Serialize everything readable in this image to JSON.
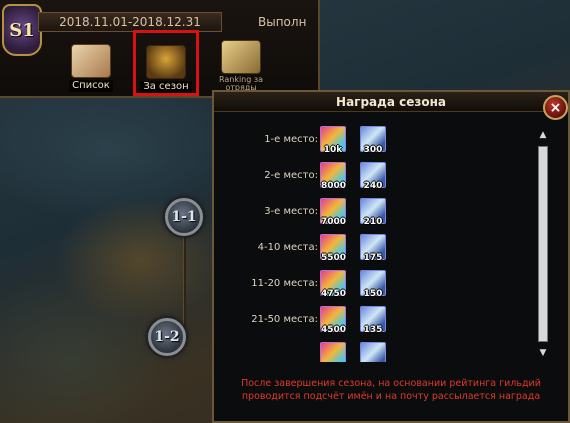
{
  "header": {
    "date_range": "2018.11.01-2018.12.31",
    "title_right": "Выполн",
    "season_badge": "S1"
  },
  "tabs": [
    {
      "label": "Список",
      "icon": "scroll-icon"
    },
    {
      "label": "За сезон",
      "icon": "treasure-chest-icon",
      "selected": true
    },
    {
      "label": "Ranking за отряды",
      "icon": "open-book-icon"
    }
  ],
  "map": {
    "nodes": [
      "1-1",
      "1-2"
    ]
  },
  "panel": {
    "title": "Награда сезона",
    "close_label": "×",
    "rows": [
      {
        "place": "1-е место:",
        "reward_a": "10k",
        "reward_b": "300"
      },
      {
        "place": "2-е место:",
        "reward_a": "8000",
        "reward_b": "240"
      },
      {
        "place": "3-е место:",
        "reward_a": "7000",
        "reward_b": "210"
      },
      {
        "place": "4-10 места:",
        "reward_a": "5500",
        "reward_b": "175"
      },
      {
        "place": "11-20 места:",
        "reward_a": "4750",
        "reward_b": "150"
      },
      {
        "place": "21-50 места:",
        "reward_a": "4500",
        "reward_b": "135"
      }
    ],
    "scroll_up": "▲",
    "scroll_down": "▼",
    "footer_line1": "После завершения сезона, на основании рейтинга гильдий",
    "footer_line2": "проводится подсчёт имён и на почту  рассылается награда"
  },
  "colors": {
    "highlight": "#d81212",
    "footer_text": "#e13a2a"
  }
}
